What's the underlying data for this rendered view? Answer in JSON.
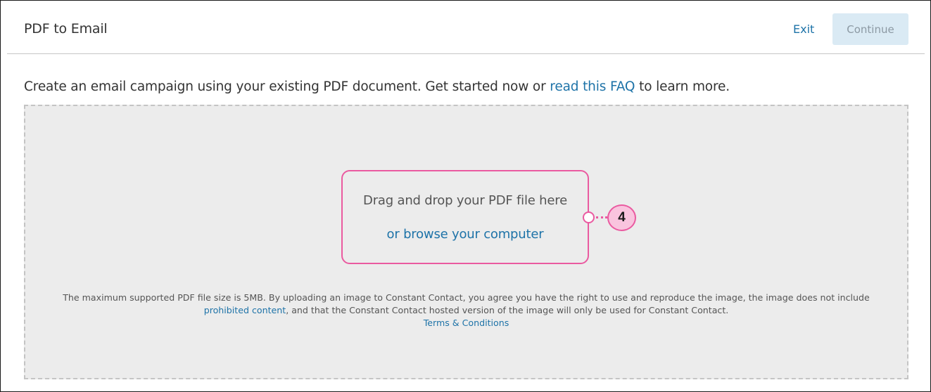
{
  "header": {
    "title": "PDF to Email",
    "exit_label": "Exit",
    "continue_label": "Continue"
  },
  "intro": {
    "text_before": "Create an email campaign using your existing PDF document. Get started now or ",
    "faq_link": "read this FAQ",
    "text_after": " to learn more."
  },
  "upload": {
    "drag_text": "Drag and drop your PDF file here",
    "browse_link": "or browse your computer"
  },
  "callout": {
    "number": "4"
  },
  "disclaimer": {
    "line1": "The maximum supported PDF file size is 5MB. By uploading an image to Constant Contact, you agree you have the right to use and reproduce the image, the image does not include",
    "prohibited_link": "prohibited content",
    "line2_after": ", and that the Constant Contact hosted version of the image will only be used for Constant Contact.",
    "terms_link": "Terms & Conditions"
  },
  "colors": {
    "link": "#1e73a8",
    "callout": "#ea5aa0",
    "callout_fill": "#f9c4de",
    "continue_bg": "#daeaf4"
  }
}
